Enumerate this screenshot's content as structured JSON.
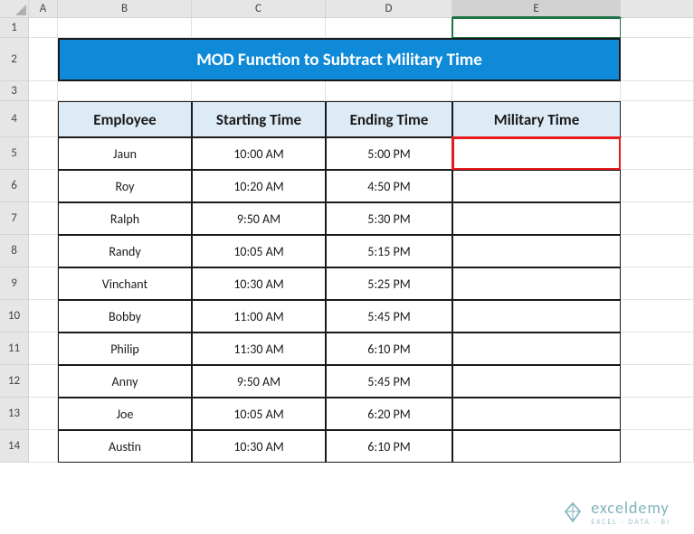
{
  "columns": [
    "A",
    "B",
    "C",
    "D",
    "E"
  ],
  "rows": [
    "1",
    "2",
    "3",
    "4",
    "5",
    "6",
    "7",
    "8",
    "9",
    "10",
    "11",
    "12",
    "13",
    "14"
  ],
  "selected_column": "E",
  "title": "MOD Function to Subtract Military Time",
  "headers": {
    "employee": "Employee",
    "starting": "Starting Time",
    "ending": "Ending Time",
    "military": "Military Time"
  },
  "chart_data": {
    "type": "table",
    "columns": [
      "Employee",
      "Starting Time",
      "Ending Time",
      "Military Time"
    ],
    "rows": [
      {
        "employee": "Jaun",
        "start": "10:00 AM",
        "end": "5:00 PM",
        "military": ""
      },
      {
        "employee": "Roy",
        "start": "10:20 AM",
        "end": "4:50 PM",
        "military": ""
      },
      {
        "employee": "Ralph",
        "start": "9:50 AM",
        "end": "5:30 PM",
        "military": ""
      },
      {
        "employee": "Randy",
        "start": "10:05 AM",
        "end": "5:15 PM",
        "military": ""
      },
      {
        "employee": "Vinchant",
        "start": "10:30 AM",
        "end": "5:25 PM",
        "military": ""
      },
      {
        "employee": "Bobby",
        "start": "11:00 AM",
        "end": "5:45 PM",
        "military": ""
      },
      {
        "employee": "Philip",
        "start": "11:30 AM",
        "end": "6:10 PM",
        "military": ""
      },
      {
        "employee": "Anny",
        "start": "9:50 AM",
        "end": "5:45 PM",
        "military": ""
      },
      {
        "employee": "Joe",
        "start": "10:05 AM",
        "end": "6:20 PM",
        "military": ""
      },
      {
        "employee": "Austin",
        "start": "10:30 AM",
        "end": "6:10 PM",
        "military": ""
      }
    ]
  },
  "watermark": {
    "brand": "exceldemy",
    "tagline": "EXCEL · DATA · BI"
  }
}
